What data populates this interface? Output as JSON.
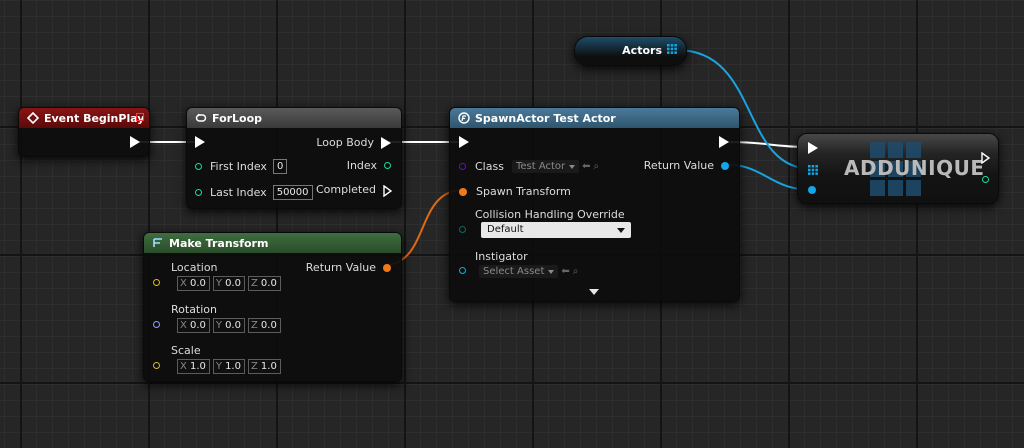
{
  "nodes": {
    "event_begin_play": {
      "title": "Event BeginPlay"
    },
    "for_loop": {
      "title": "ForLoop",
      "pins": {
        "first_index_label": "First Index",
        "first_index_value": "0",
        "last_index_label": "Last Index",
        "last_index_value": "50000",
        "loop_body": "Loop Body",
        "index": "Index",
        "completed": "Completed"
      }
    },
    "make_transform": {
      "title": "Make Transform",
      "pins": {
        "location_label": "Location",
        "rotation_label": "Rotation",
        "scale_label": "Scale",
        "return_value": "Return Value"
      },
      "location": {
        "x": "0.0",
        "y": "0.0",
        "z": "0.0"
      },
      "rotation": {
        "x": "0.0",
        "y": "0.0",
        "z": "0.0"
      },
      "scale": {
        "x": "1.0",
        "y": "1.0",
        "z": "1.0"
      },
      "axes": {
        "x": "X",
        "y": "Y",
        "z": "Z"
      }
    },
    "spawn_actor": {
      "title": "SpawnActor Test Actor",
      "pins": {
        "class_label": "Class",
        "class_value": "Test Actor",
        "return_value": "Return Value",
        "spawn_transform": "Spawn Transform",
        "collision_label": "Collision Handling Override",
        "collision_value": "Default",
        "instigator_label": "Instigator",
        "instigator_value": "Select Asset"
      }
    },
    "actors_var": {
      "label": "Actors"
    },
    "add_unique": {
      "title": "ADDUNIQUE"
    }
  },
  "colors": {
    "exec": "#ffffff",
    "int_pin": "#1ed9a0",
    "struct_pin": "#f07a1a",
    "object_pin": "#10a8e8",
    "class_pin": "#5a1aa8",
    "vector_pin": "#e0b81a",
    "rotator_pin": "#8fa0ff",
    "event_header": "#7a0f0f",
    "function_header": "#3e6b8a",
    "pure_header": "#335c33",
    "macro_header": "#4a4a4a"
  },
  "icons": {
    "event": "event-diamond-icon",
    "loop": "loop-arrows-icon",
    "function": "function-f-icon",
    "pure": "pure-function-icon",
    "array": "array-grid-icon"
  }
}
